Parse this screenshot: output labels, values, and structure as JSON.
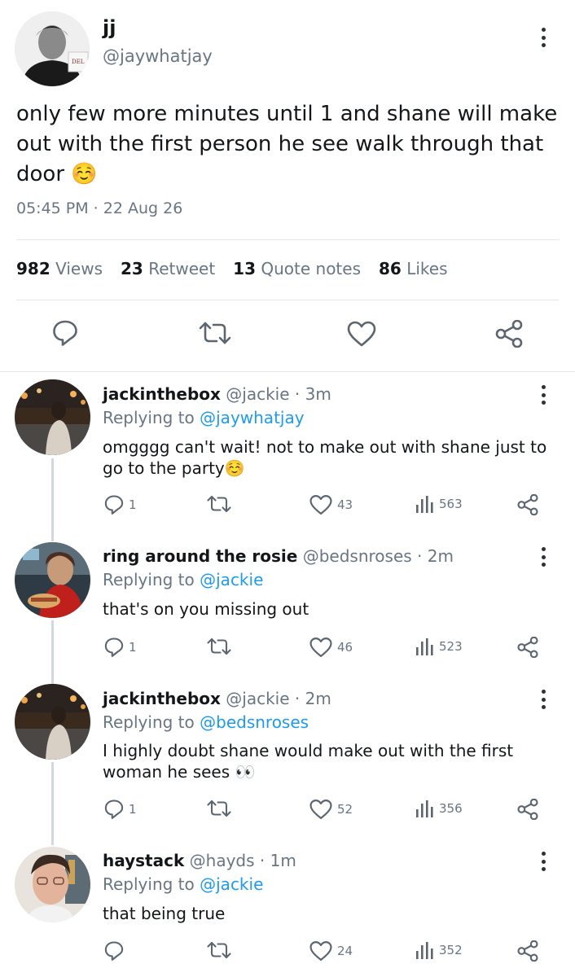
{
  "tweet": {
    "author_name": "jj",
    "author_handle": "@jaywhatjay",
    "text": "only few more minutes until 1 and shane will make out with the first person he see walk through that door ☺️",
    "timestamp": "05:45 PM · 22 Aug 26",
    "stats": {
      "views_count": "982",
      "views_label": "Views",
      "retweets_count": "23",
      "retweets_label": "Retweet",
      "quotes_count": "13",
      "quotes_label": "Quote notes",
      "likes_count": "86",
      "likes_label": "Likes"
    }
  },
  "replies": [
    {
      "name": "jackinthebox",
      "handle": "@jackie",
      "time": "· 3m",
      "replying_label": "Replying to",
      "replying_to": "@jaywhatjay",
      "text": "omgggg can't wait! not to make out with shane just to go to the party☺️",
      "replies": "1",
      "retweets": "",
      "likes": "43",
      "views": "563"
    },
    {
      "name": "ring around the rosie",
      "handle": "@bedsnroses",
      "time": "· 2m",
      "replying_label": "Replying to",
      "replying_to": "@jackie",
      "text": "that's on you missing out",
      "replies": "1",
      "retweets": "",
      "likes": "46",
      "views": "523"
    },
    {
      "name": "jackinthebox",
      "handle": "@jackie",
      "time": "· 2m",
      "replying_label": "Replying to",
      "replying_to": "@bedsnroses",
      "text": "I highly doubt shane would make out with the first woman he sees 👀",
      "replies": "1",
      "retweets": "",
      "likes": "52",
      "views": "356"
    },
    {
      "name": "haystack",
      "handle": "@hayds",
      "time": "· 1m",
      "replying_label": "Replying to",
      "replying_to": "@jackie",
      "text": "that being true",
      "replies": "",
      "retweets": "",
      "likes": "24",
      "views": "352"
    }
  ],
  "colors": {
    "accent": "#1d9bf0",
    "muted": "#687684",
    "divider": "#e3e6e9"
  },
  "icons": [
    "more-icon",
    "reply-icon",
    "retweet-icon",
    "like-icon",
    "views-icon",
    "share-icon"
  ]
}
